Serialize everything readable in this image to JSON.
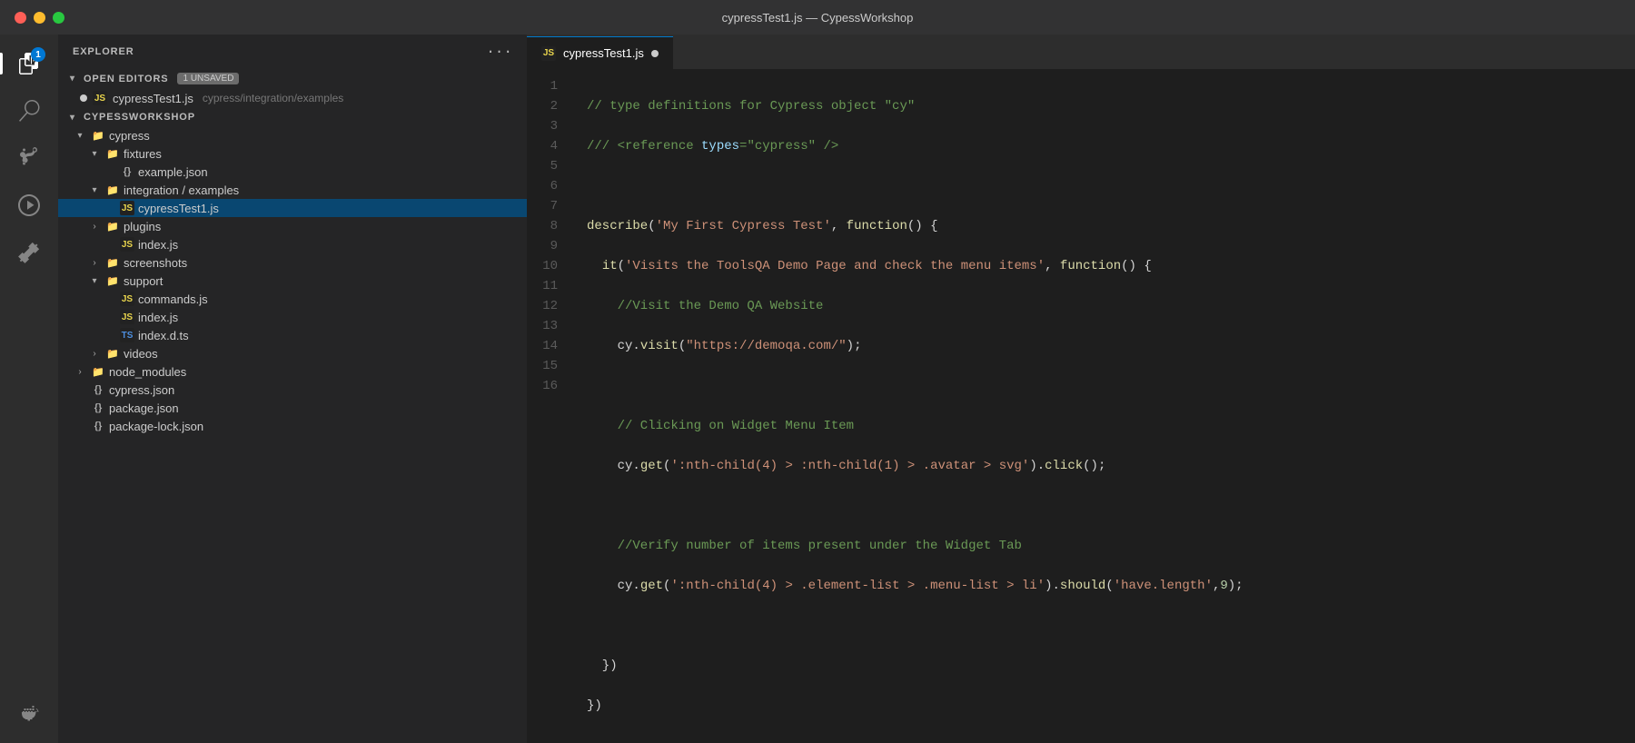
{
  "titlebar": {
    "title": "cypressTest1.js — CypessWorkshop",
    "buttons": [
      "close",
      "minimize",
      "maximize"
    ]
  },
  "activity_bar": {
    "items": [
      {
        "name": "explorer",
        "active": true,
        "badge": "1"
      },
      {
        "name": "search",
        "active": false
      },
      {
        "name": "source-control",
        "active": false
      },
      {
        "name": "run-debug",
        "active": false
      },
      {
        "name": "extensions",
        "active": false
      },
      {
        "name": "docker",
        "active": false
      }
    ]
  },
  "sidebar": {
    "header": "EXPLORER",
    "sections": {
      "open_editors": {
        "label": "OPEN EDITORS",
        "badge": "1 UNSAVED",
        "files": [
          {
            "name": "cypressTest1.js",
            "path": "cypress/integration/examples",
            "unsaved": true,
            "type": "js"
          }
        ]
      },
      "workspace": {
        "label": "CYPESSWORKSHOP",
        "items": [
          {
            "type": "folder-open",
            "name": "cypress",
            "indent": 1
          },
          {
            "type": "folder-open",
            "name": "fixtures",
            "indent": 2
          },
          {
            "type": "json",
            "name": "example.json",
            "indent": 3
          },
          {
            "type": "folder-open",
            "name": "integration / examples",
            "indent": 2
          },
          {
            "type": "js",
            "name": "cypressTest1.js",
            "indent": 3,
            "active": true
          },
          {
            "type": "folder-closed",
            "name": "plugins",
            "indent": 2
          },
          {
            "type": "js",
            "name": "index.js",
            "indent": 3
          },
          {
            "type": "folder-closed",
            "name": "screenshots",
            "indent": 2
          },
          {
            "type": "folder-open",
            "name": "support",
            "indent": 2
          },
          {
            "type": "js",
            "name": "commands.js",
            "indent": 3
          },
          {
            "type": "js",
            "name": "index.js",
            "indent": 3
          },
          {
            "type": "ts",
            "name": "index.d.ts",
            "indent": 3
          },
          {
            "type": "folder-closed",
            "name": "videos",
            "indent": 2
          },
          {
            "type": "folder-closed",
            "name": "node_modules",
            "indent": 1
          },
          {
            "type": "json",
            "name": "cypress.json",
            "indent": 1
          },
          {
            "type": "json",
            "name": "package.json",
            "indent": 1
          },
          {
            "type": "json",
            "name": "package-lock.json",
            "indent": 1
          }
        ]
      }
    }
  },
  "editor": {
    "tab": {
      "filename": "cypressTest1.js",
      "unsaved": true,
      "type": "js"
    },
    "lines": [
      {
        "num": 1,
        "tokens": [
          {
            "class": "c-comment",
            "text": "// type definitions for Cypress object \"cy\""
          }
        ]
      },
      {
        "num": 2,
        "tokens": [
          {
            "class": "c-comment",
            "text": "/// <reference "
          },
          {
            "class": "c-param",
            "text": "types"
          },
          {
            "class": "c-comment",
            "text": "=\"cypress\" />"
          }
        ]
      },
      {
        "num": 3,
        "tokens": []
      },
      {
        "num": 4,
        "tokens": [
          {
            "class": "c-describe",
            "text": "describe"
          },
          {
            "class": "c-plain",
            "text": "("
          },
          {
            "class": "c-string",
            "text": "'My First Cypress Test'"
          },
          {
            "class": "c-plain",
            "text": ", "
          },
          {
            "class": "c-keyword",
            "text": "function"
          },
          {
            "class": "c-plain",
            "text": "() {"
          }
        ]
      },
      {
        "num": 5,
        "tokens": [
          {
            "class": "c-plain",
            "text": "  "
          },
          {
            "class": "c-it",
            "text": "it"
          },
          {
            "class": "c-plain",
            "text": "("
          },
          {
            "class": "c-string",
            "text": "'Visits the ToolsQA Demo Page and check the menu items'"
          },
          {
            "class": "c-plain",
            "text": ", "
          },
          {
            "class": "c-keyword",
            "text": "function"
          },
          {
            "class": "c-plain",
            "text": "() {"
          }
        ]
      },
      {
        "num": 6,
        "tokens": [
          {
            "class": "c-comment",
            "text": "    //Visit the Demo QA Website"
          }
        ]
      },
      {
        "num": 7,
        "tokens": [
          {
            "class": "c-plain",
            "text": "    cy."
          },
          {
            "class": "c-method",
            "text": "visit"
          },
          {
            "class": "c-plain",
            "text": "("
          },
          {
            "class": "c-string",
            "text": "\"https://demoqa.com/\""
          },
          {
            "class": "c-plain",
            "text": ");"
          }
        ]
      },
      {
        "num": 8,
        "tokens": []
      },
      {
        "num": 9,
        "tokens": [
          {
            "class": "c-comment",
            "text": "    // Clicking on Widget Menu Item"
          }
        ]
      },
      {
        "num": 10,
        "tokens": [
          {
            "class": "c-plain",
            "text": "    cy."
          },
          {
            "class": "c-method",
            "text": "get"
          },
          {
            "class": "c-plain",
            "text": "("
          },
          {
            "class": "c-string",
            "text": "':nth-child(4) > :nth-child(1) > .avatar > svg'"
          },
          {
            "class": "c-plain",
            "text": ")."
          },
          {
            "class": "c-method",
            "text": "click"
          },
          {
            "class": "c-plain",
            "text": "();"
          }
        ]
      },
      {
        "num": 11,
        "tokens": []
      },
      {
        "num": 12,
        "tokens": [
          {
            "class": "c-comment",
            "text": "    //Verify number of items present under the Widget Tab"
          }
        ]
      },
      {
        "num": 13,
        "tokens": [
          {
            "class": "c-plain",
            "text": "    cy."
          },
          {
            "class": "c-method",
            "text": "get"
          },
          {
            "class": "c-plain",
            "text": "("
          },
          {
            "class": "c-string",
            "text": "':nth-child(4) > .element-list > .menu-list > li'"
          },
          {
            "class": "c-plain",
            "text": ")."
          },
          {
            "class": "c-method",
            "text": "should"
          },
          {
            "class": "c-plain",
            "text": "("
          },
          {
            "class": "c-string",
            "text": "'have.length'"
          },
          {
            "class": "c-plain",
            "text": ","
          },
          {
            "class": "c-number",
            "text": "9"
          },
          {
            "class": "c-plain",
            "text": ");"
          }
        ]
      },
      {
        "num": 14,
        "tokens": []
      },
      {
        "num": 15,
        "tokens": [
          {
            "class": "c-plain",
            "text": "  })"
          }
        ]
      },
      {
        "num": 16,
        "tokens": [
          {
            "class": "c-plain",
            "text": "})"
          }
        ]
      }
    ]
  }
}
